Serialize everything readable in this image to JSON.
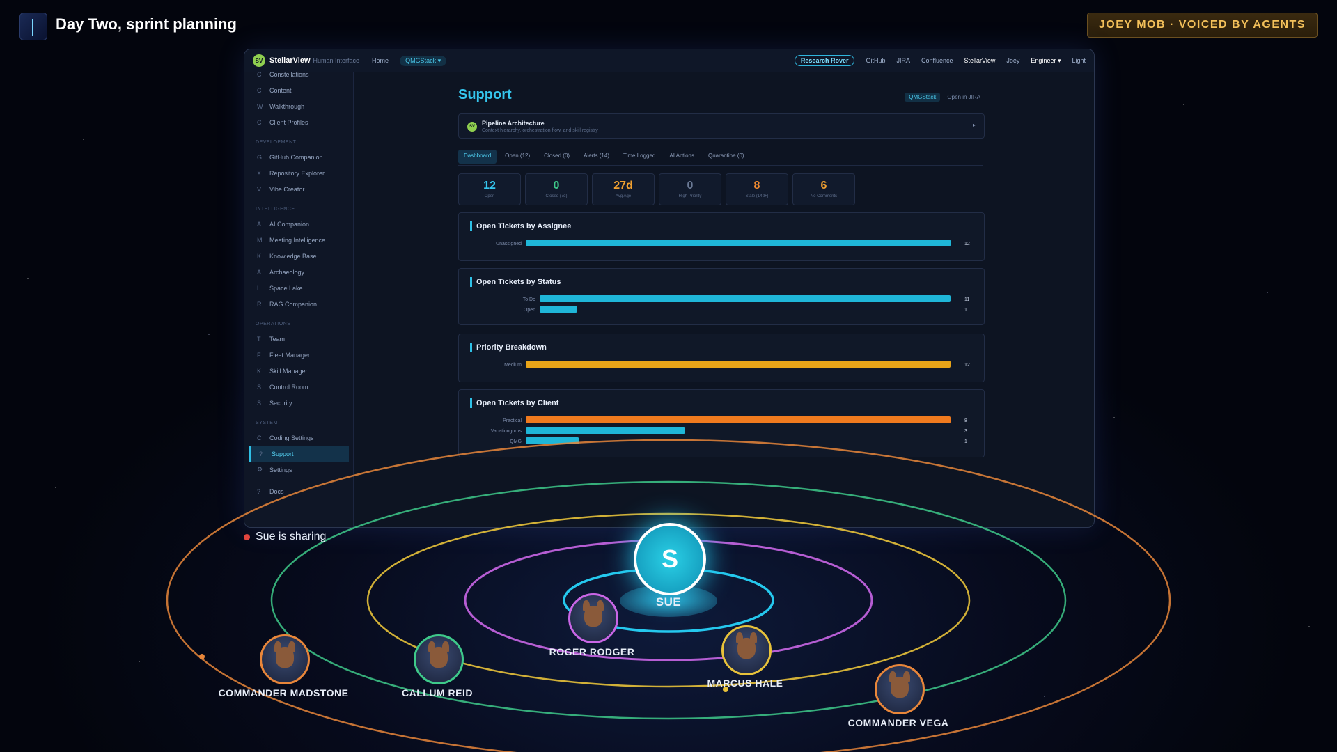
{
  "meeting": {
    "title": "Day Two, sprint planning",
    "badge": "JOEY MOB · VOICED BY AGENTS",
    "sharing_text": "Sue is sharing",
    "presenter": {
      "initial": "S",
      "name": "SUE"
    },
    "participants": [
      {
        "name": "ROGER RODGER",
        "ring_color": "#c966e6"
      },
      {
        "name": "MARCUS HALE",
        "ring_color": "#e8c23a"
      },
      {
        "name": "CALLUM REID",
        "ring_color": "#3ec98a"
      },
      {
        "name": "COMMANDER MADSTONE",
        "ring_color": "#e8863a"
      },
      {
        "name": "COMMANDER VEGA",
        "ring_color": "#e8863a"
      }
    ]
  },
  "app": {
    "logo": "SV",
    "name": "StellarView",
    "subtitle": "Human Interface",
    "nav": {
      "home": "Home",
      "stack": "QMGStack ▾"
    },
    "right_nav": {
      "research": "Research Rover",
      "github": "GitHub",
      "jira": "JIRA",
      "confluence": "Confluence",
      "stellarview": "StellarView",
      "joey": "Joey",
      "role": "Engineer ▾",
      "theme": "Light"
    },
    "sidebar": {
      "top_items": [
        {
          "icon": "C",
          "label": "Constellations"
        },
        {
          "icon": "C",
          "label": "Content"
        },
        {
          "icon": "W",
          "label": "Walkthrough"
        },
        {
          "icon": "C",
          "label": "Client Profiles"
        }
      ],
      "sections": [
        {
          "title": "DEVELOPMENT",
          "items": [
            {
              "icon": "G",
              "label": "GitHub Companion"
            },
            {
              "icon": "X",
              "label": "Repository Explorer"
            },
            {
              "icon": "V",
              "label": "Vibe Creator"
            }
          ]
        },
        {
          "title": "INTELLIGENCE",
          "items": [
            {
              "icon": "A",
              "label": "AI Companion"
            },
            {
              "icon": "M",
              "label": "Meeting Intelligence"
            },
            {
              "icon": "K",
              "label": "Knowledge Base"
            },
            {
              "icon": "A",
              "label": "Archaeology"
            },
            {
              "icon": "L",
              "label": "Space Lake"
            },
            {
              "icon": "R",
              "label": "RAG Companion"
            }
          ]
        },
        {
          "title": "OPERATIONS",
          "items": [
            {
              "icon": "T",
              "label": "Team"
            },
            {
              "icon": "F",
              "label": "Fleet Manager"
            },
            {
              "icon": "K",
              "label": "Skill Manager"
            },
            {
              "icon": "S",
              "label": "Control Room"
            },
            {
              "icon": "S",
              "label": "Security"
            }
          ]
        },
        {
          "title": "SYSTEM",
          "items": [
            {
              "icon": "C",
              "label": "Coding Settings"
            },
            {
              "icon": "?",
              "label": "Support"
            },
            {
              "icon": "⚙",
              "label": "Settings"
            }
          ]
        }
      ],
      "footer": {
        "icon": "?",
        "label": "Docs"
      }
    },
    "page": {
      "title": "Support",
      "stack_chip": "QMGStack",
      "jira_link": "Open in JIRA",
      "pipeline": {
        "logo": "SV",
        "title": "Pipeline Architecture",
        "subtitle": "Context hierarchy, orchestration flow, and skill registry",
        "chevron": "▸"
      },
      "tabs": [
        "Dashboard",
        "Open (12)",
        "Closed (0)",
        "Alerts (14)",
        "Time Logged",
        "AI Actions",
        "Quarantine (0)"
      ],
      "stats": [
        {
          "value": "12",
          "label": "Open",
          "color": "#35c6ee"
        },
        {
          "value": "0",
          "label": "Closed (7d)",
          "color": "#3ec98a"
        },
        {
          "value": "27d",
          "label": "Avg Age",
          "color": "#f0a030"
        },
        {
          "value": "0",
          "label": "High Priority",
          "color": "#6b7a96"
        },
        {
          "value": "8",
          "label": "Stale (14d+)",
          "color": "#f08a30"
        },
        {
          "value": "6",
          "label": "No Comments",
          "color": "#f0a030"
        }
      ]
    }
  },
  "chart_data": [
    {
      "type": "bar",
      "title": "Open Tickets by Assignee",
      "categories": [
        "Unassigned"
      ],
      "values": [
        12
      ],
      "color": "#1fb6d8"
    },
    {
      "type": "bar",
      "title": "Open Tickets by Status",
      "categories": [
        "To Do",
        "Open"
      ],
      "values": [
        11,
        1
      ],
      "color": "#1fb6d8"
    },
    {
      "type": "bar",
      "title": "Priority Breakdown",
      "categories": [
        "Medium"
      ],
      "values": [
        12
      ],
      "color": "#e8a418"
    },
    {
      "type": "bar",
      "title": "Open Tickets by Client",
      "categories": [
        "Practical",
        "Vacationgurus",
        "QMG"
      ],
      "values": [
        8,
        3,
        1
      ],
      "colors": [
        "#f07a1e",
        "#1fb6d8",
        "#1fb6d8"
      ]
    }
  ]
}
